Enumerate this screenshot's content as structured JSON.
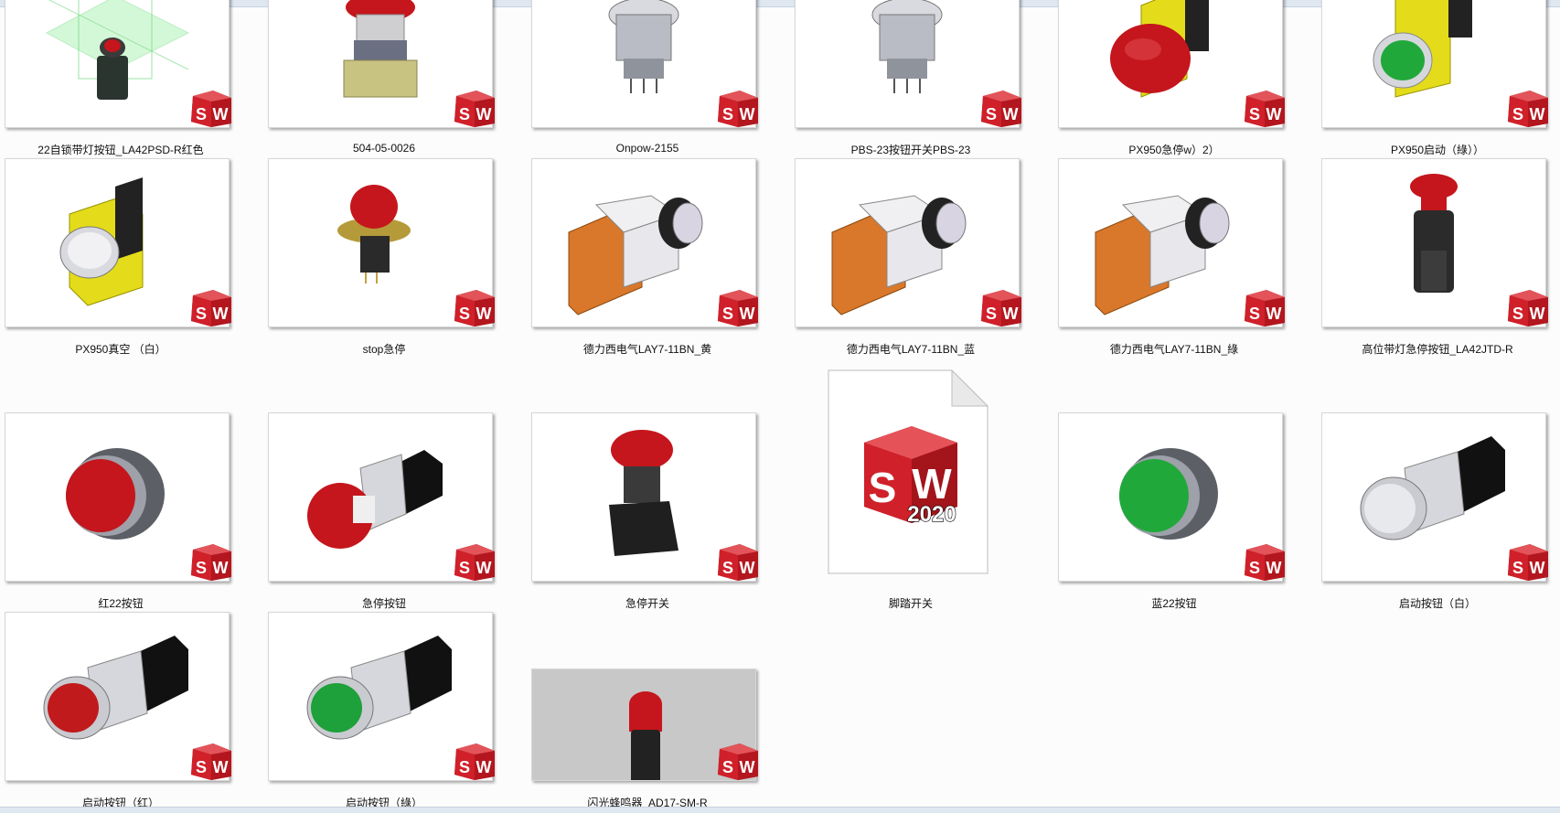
{
  "window": {
    "view": "large-icons"
  },
  "files": [
    {
      "name": "22自锁带灯按钮_LA42PSD-R红色",
      "icon": "push-button-green-wireframe-icon"
    },
    {
      "name": "504-05-0026",
      "icon": "red-mushroom-button-icon"
    },
    {
      "name": "Onpow-2155",
      "icon": "metal-button-icon"
    },
    {
      "name": "PBS-23按钮开关PBS-23",
      "icon": "metal-button-icon"
    },
    {
      "name": "PX950急停w）2）",
      "icon": "red-emergency-stop-icon"
    },
    {
      "name": "PX950启动（綠））",
      "icon": "green-start-button-icon"
    },
    {
      "name": "PX950真空 （白）",
      "icon": "white-button-yellow-icon"
    },
    {
      "name": "stop急停",
      "icon": "red-stop-button-icon"
    },
    {
      "name": "德力西电气LAY7-11BN_黄",
      "icon": "contact-block-button-icon"
    },
    {
      "name": "德力西电气LAY7-11BN_蓝",
      "icon": "contact-block-button-icon"
    },
    {
      "name": "德力西电气LAY7-11BN_綠",
      "icon": "contact-block-button-icon"
    },
    {
      "name": "高位带灯急停按钮_LA42JTD-R",
      "icon": "tall-emergency-stop-icon"
    },
    {
      "name": "红22按钮",
      "icon": "red-flat-button-icon"
    },
    {
      "name": "急停按钮",
      "icon": "red-mushroom-square-icon"
    },
    {
      "name": "急停开关",
      "icon": "red-emergency-switch-icon"
    },
    {
      "name": "脚踏开关",
      "icon": "solidworks-2020-document-icon"
    },
    {
      "name": "蓝22按钮",
      "icon": "green-flat-button-icon"
    },
    {
      "name": "启动按钮（白）",
      "icon": "white-square-button-icon"
    },
    {
      "name": "启动按钮（红）",
      "icon": "red-square-button-icon"
    },
    {
      "name": "启动按钮（綠）",
      "icon": "green-square-button-icon"
    },
    {
      "name": "闪光蜂鸣器_AD17-SM-R",
      "icon": "flash-buzzer-icon"
    }
  ],
  "badge": {
    "s": "S",
    "w": "W"
  },
  "document_icon": {
    "s": "S",
    "w": "W",
    "version": "2020"
  },
  "colors": {
    "sw_red": "#d0202a",
    "sw_dark_red": "#9b1218",
    "emergency_red": "#c4161c",
    "button_green": "#21a83a",
    "housing_yellow": "#e4dc1a"
  }
}
